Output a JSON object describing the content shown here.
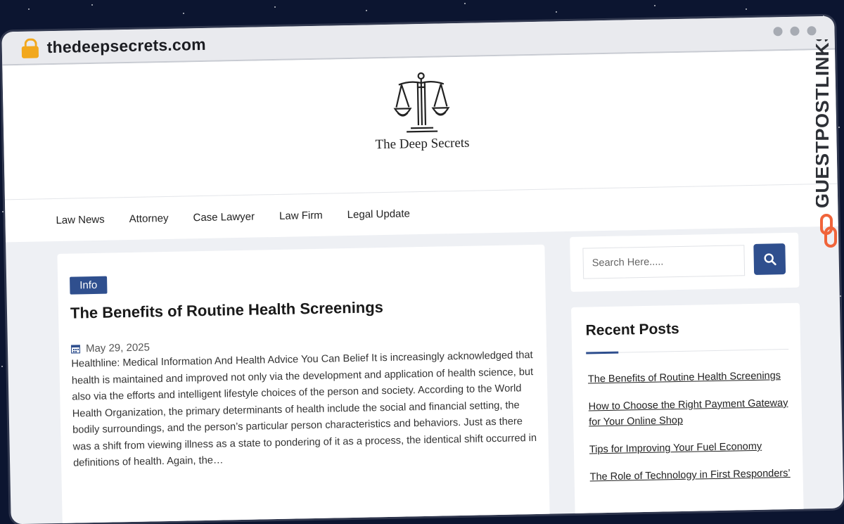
{
  "browser": {
    "url": "thedeepsecrets.com"
  },
  "site": {
    "name": "The Deep Secrets"
  },
  "nav": {
    "items": [
      "Law News",
      "Attorney",
      "Case Lawyer",
      "Law Firm",
      "Legal Update"
    ]
  },
  "post": {
    "category": "Info",
    "title": "The Benefits of Routine Health Screenings",
    "date": "May 29, 2025",
    "excerpt": "Healthline: Medical Information And Health Advice You Can Belief It is increasingly acknowledged that health is maintained and improved not only via the development and application of health science, but also via the efforts and intelligent lifestyle choices of the person and society. According to the World Health Organization, the primary determinants of health include the social and financial setting, the bodily surroundings, and the person’s particular person characteristics and behaviors. Just as there was a shift from viewing illness as a state to pondering of it as a process, the identical shift occurred in definitions of health. Again, the…"
  },
  "sidebar": {
    "search": {
      "placeholder": "Search Here....."
    },
    "recent": {
      "title": "Recent Posts",
      "items": [
        "The Benefits of Routine Health Screenings",
        "How to Choose the Right Payment Gateway for Your Online Shop",
        "Tips for Improving Your Fuel Economy",
        "The Role of Technology in First Responders’"
      ]
    }
  },
  "watermark": {
    "text": "GUESTPOSTLINKS"
  },
  "colors": {
    "accent": "#2f4f8e",
    "lock": "#f2a81d",
    "watermark_icon": "#f0643a"
  }
}
